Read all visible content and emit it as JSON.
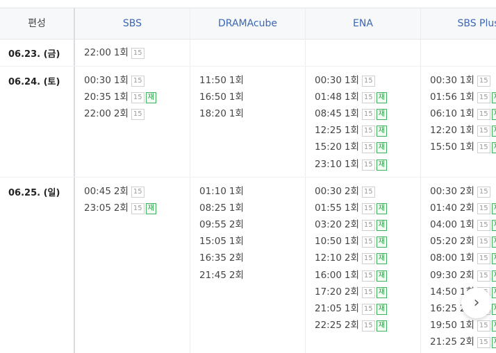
{
  "header": {
    "label": "편성",
    "channels": [
      "SBS",
      "DRAMAcube",
      "ENA",
      "SBS Plus"
    ]
  },
  "rows": [
    {
      "date": "06.23. (금)",
      "cells": [
        [
          {
            "time": "22:00",
            "ep": "1회",
            "age": "15",
            "rerun": false
          }
        ],
        [],
        [],
        []
      ]
    },
    {
      "date": "06.24. (토)",
      "cells": [
        [
          {
            "time": "00:30",
            "ep": "1회",
            "age": "15",
            "rerun": false
          },
          {
            "time": "20:35",
            "ep": "1회",
            "age": "15",
            "rerun": true
          },
          {
            "time": "22:00",
            "ep": "2회",
            "age": "15",
            "rerun": false
          }
        ],
        [
          {
            "time": "11:50",
            "ep": "1회"
          },
          {
            "time": "16:50",
            "ep": "1회"
          },
          {
            "time": "18:20",
            "ep": "1회"
          }
        ],
        [
          {
            "time": "00:30",
            "ep": "1회",
            "age": "15",
            "rerun": false
          },
          {
            "time": "01:48",
            "ep": "1회",
            "age": "15",
            "rerun": true
          },
          {
            "time": "08:45",
            "ep": "1회",
            "age": "15",
            "rerun": true
          },
          {
            "time": "12:25",
            "ep": "1회",
            "age": "15",
            "rerun": true
          },
          {
            "time": "15:20",
            "ep": "1회",
            "age": "15",
            "rerun": true
          },
          {
            "time": "23:10",
            "ep": "1회",
            "age": "15",
            "rerun": true
          }
        ],
        [
          {
            "time": "00:30",
            "ep": "1회",
            "age": "15",
            "rerun": false
          },
          {
            "time": "01:56",
            "ep": "1회",
            "age": "15",
            "rerun": true
          },
          {
            "time": "06:10",
            "ep": "1회",
            "age": "15",
            "rerun": true
          },
          {
            "time": "12:20",
            "ep": "1회",
            "age": "15",
            "rerun": true
          },
          {
            "time": "15:50",
            "ep": "1회",
            "age": "15",
            "rerun": true
          }
        ]
      ]
    },
    {
      "date": "06.25. (일)",
      "cells": [
        [
          {
            "time": "00:45",
            "ep": "2회",
            "age": "15",
            "rerun": false
          },
          {
            "time": "23:05",
            "ep": "2회",
            "age": "15",
            "rerun": true
          }
        ],
        [
          {
            "time": "01:10",
            "ep": "1회"
          },
          {
            "time": "08:25",
            "ep": "1회"
          },
          {
            "time": "09:55",
            "ep": "2회"
          },
          {
            "time": "15:05",
            "ep": "1회"
          },
          {
            "time": "16:35",
            "ep": "2회"
          },
          {
            "time": "21:45",
            "ep": "2회"
          }
        ],
        [
          {
            "time": "00:30",
            "ep": "2회",
            "age": "15",
            "rerun": false
          },
          {
            "time": "01:55",
            "ep": "1회",
            "age": "15",
            "rerun": true
          },
          {
            "time": "03:20",
            "ep": "2회",
            "age": "15",
            "rerun": true
          },
          {
            "time": "10:50",
            "ep": "1회",
            "age": "15",
            "rerun": true
          },
          {
            "time": "12:10",
            "ep": "2회",
            "age": "15",
            "rerun": true
          },
          {
            "time": "16:00",
            "ep": "1회",
            "age": "15",
            "rerun": true
          },
          {
            "time": "17:20",
            "ep": "2회",
            "age": "15",
            "rerun": true
          },
          {
            "time": "21:05",
            "ep": "1회",
            "age": "15",
            "rerun": true
          },
          {
            "time": "22:25",
            "ep": "2회",
            "age": "15",
            "rerun": true
          }
        ],
        [
          {
            "time": "00:30",
            "ep": "2회",
            "age": "15",
            "rerun": false
          },
          {
            "time": "01:40",
            "ep": "2회",
            "age": "15",
            "rerun": true
          },
          {
            "time": "04:00",
            "ep": "1회",
            "age": "15",
            "rerun": true
          },
          {
            "time": "05:20",
            "ep": "2회",
            "age": "15",
            "rerun": true
          },
          {
            "time": "08:00",
            "ep": "1회",
            "age": "15",
            "rerun": true
          },
          {
            "time": "09:30",
            "ep": "2회",
            "age": "15",
            "rerun": true
          },
          {
            "time": "14:50",
            "ep": "1회",
            "age": "15",
            "rerun": true
          },
          {
            "time": "16:25",
            "ep": "2회",
            "age": "15",
            "rerun": true
          },
          {
            "time": "19:50",
            "ep": "1회",
            "age": "15",
            "rerun": true
          },
          {
            "time": "21:25",
            "ep": "2회",
            "age": "15",
            "rerun": true
          }
        ]
      ]
    }
  ],
  "rerun_label": "재",
  "next_button": {
    "icon": "chevron-right-icon",
    "glyph": "›"
  },
  "colors": {
    "channel_header": "#3a66b7",
    "rerun_badge": "#3fb05a",
    "age_badge": "#cfcfcf"
  }
}
